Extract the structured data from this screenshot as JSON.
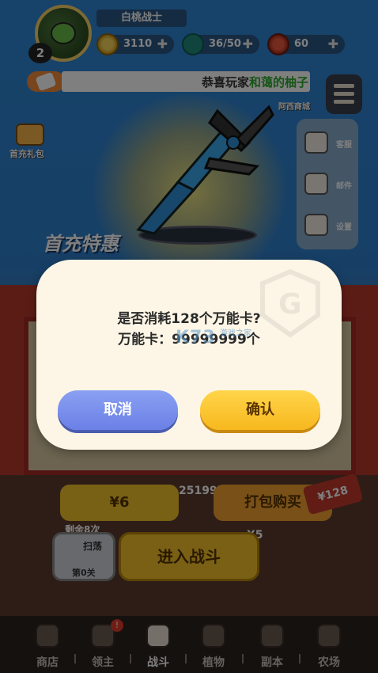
{
  "player": {
    "name": "白桃战士",
    "level": "2"
  },
  "resources": {
    "coins": "3110",
    "energy": "36/50",
    "gems": "60"
  },
  "notice": {
    "prefix": "恭喜玩家",
    "highlight": "和蔼的柚子"
  },
  "side_menu": {
    "mall_label": "阿西商城",
    "items": [
      {
        "label": "客服",
        "icon": "megaphone-icon"
      },
      {
        "label": "邮件",
        "icon": "mail-icon"
      },
      {
        "label": "设置",
        "icon": "gear-icon"
      }
    ]
  },
  "first_pack_label": "首充礼包",
  "promo_title": "首充特惠",
  "shop": {
    "power_value": "25199",
    "price_label": "¥6",
    "buy_label": "打包购买",
    "old_price": "¥128"
  },
  "battle": {
    "remaining_label": "剩余8次",
    "sweep_label": "扫荡",
    "stage_label": "第0关",
    "enter_label": "进入战斗",
    "energy_cost": "X5"
  },
  "dialog": {
    "line1": "是否消耗128个万能卡?",
    "line2": "万能卡：99999999个",
    "cancel_label": "取消",
    "confirm_label": "确认",
    "watermark": "K73",
    "watermark_sub": "游戏之家"
  },
  "nav": [
    {
      "label": "商店",
      "icon": "lock-icon",
      "active": false
    },
    {
      "label": "领主",
      "icon": "lord-icon",
      "active": false,
      "badge": "!"
    },
    {
      "label": "战斗",
      "icon": "battle-icon",
      "active": true
    },
    {
      "label": "植物",
      "icon": "plant-icon",
      "active": false
    },
    {
      "label": "副本",
      "icon": "lock-icon",
      "active": false
    },
    {
      "label": "农场",
      "icon": "lock-icon",
      "active": false
    }
  ],
  "colors": {
    "cancel": "#6b80e6",
    "confirm": "#f7b81e",
    "dialog_bg": "#fdf6e6",
    "notice_highlight": "#2eaa2e"
  }
}
